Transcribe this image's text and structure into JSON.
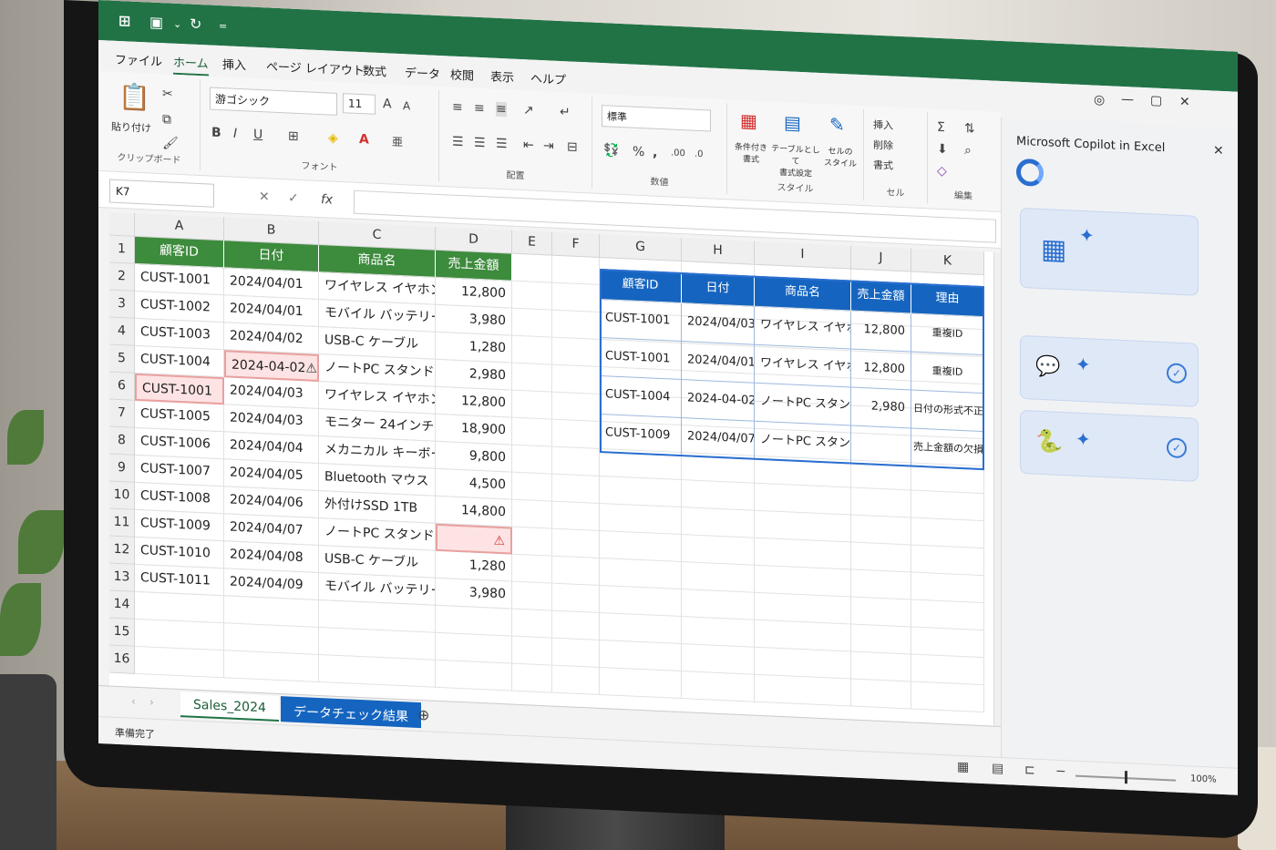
{
  "title_bar": {
    "undo_icon": "undo-icon",
    "redo_icon": "redo-icon"
  },
  "menu": [
    "ファイル",
    "ホーム",
    "挿入",
    "ページ レイアウト",
    "数式",
    "データ",
    "校閲",
    "表示",
    "ヘルプ"
  ],
  "ribbon": {
    "clipboard": {
      "paste": "貼り付け",
      "label": "クリップボード"
    },
    "font": {
      "name": "游ゴシック",
      "size": "11",
      "label": "フォント",
      "bold": "B",
      "italic": "I",
      "underline": "U"
    },
    "align": {
      "label": "配置"
    },
    "number": {
      "format": "標準",
      "label": "数値"
    },
    "styles": {
      "cond": "条件付き\n書式",
      "table": "テーブルとして\n書式設定",
      "cell": "セルの\nスタイル",
      "label": "スタイル"
    },
    "cells": {
      "insert": "挿入",
      "delete": "削除",
      "format": "書式",
      "label": "セル"
    },
    "edit": {
      "label": "編集"
    }
  },
  "formula": {
    "namebox": "K7",
    "fx": "fx"
  },
  "columns": [
    "A",
    "B",
    "C",
    "D",
    "E",
    "F",
    "G",
    "H",
    "I",
    "J",
    "K"
  ],
  "rows": [
    "1",
    "2",
    "3",
    "4",
    "5",
    "6",
    "7",
    "8",
    "9",
    "10",
    "11",
    "12",
    "13",
    "14",
    "15",
    "16"
  ],
  "table_headers": [
    "顧客ID",
    "日付",
    "商品名",
    "売上金額"
  ],
  "table_rows": [
    [
      "CUST-1001",
      "2024/04/01",
      "ワイヤレス イヤホン",
      "12,800"
    ],
    [
      "CUST-1002",
      "2024/04/01",
      "モバイル バッテリー",
      "3,980"
    ],
    [
      "CUST-1003",
      "2024/04/02",
      "USB-C ケーブル",
      "1,280"
    ],
    [
      "CUST-1004",
      "2024-04-02⚠",
      "ノートPC スタンド",
      "2,980"
    ],
    [
      "CUST-1001",
      "2024/04/03",
      "ワイヤレス イヤホン",
      "12,800"
    ],
    [
      "CUST-1005",
      "2024/04/03",
      "モニター 24インチ",
      "18,900"
    ],
    [
      "CUST-1006",
      "2024/04/04",
      "メカニカル キーボード",
      "9,800"
    ],
    [
      "CUST-1007",
      "2024/04/05",
      "Bluetooth マウス",
      "4,500"
    ],
    [
      "CUST-1008",
      "2024/04/06",
      "外付けSSD 1TB",
      "14,800"
    ],
    [
      "CUST-1009",
      "2024/04/07",
      "ノートPC スタンド",
      "⚠"
    ],
    [
      "CUST-1010",
      "2024/04/08",
      "USB-C ケーブル",
      "1,280"
    ],
    [
      "CUST-1011",
      "2024/04/09",
      "モバイル バッテリー",
      "3,980"
    ]
  ],
  "check_headers": [
    "顧客ID",
    "日付",
    "商品名",
    "売上金額",
    "理由"
  ],
  "check_rows": [
    [
      "CUST-1001",
      "2024/04/03",
      "ワイヤレス イヤホン",
      "12,800",
      "重複ID"
    ],
    [
      "CUST-1001",
      "2024/04/01",
      "ワイヤレス イヤホン",
      "12,800",
      "重複ID"
    ],
    [
      "CUST-1004",
      "2024-04-02",
      "ノートPC スタンド",
      "2,980",
      "日付の形式不正"
    ],
    [
      "CUST-1009",
      "2024/04/07",
      "ノートPC スタンド",
      "",
      "売上金額の欠損"
    ]
  ],
  "sheets": {
    "tab1": "Sales_2024",
    "tab2": "データチェック結果",
    "add": "⊕"
  },
  "status": {
    "ready": "準備完了",
    "zoom": "100%"
  },
  "copilot": {
    "title": "Microsoft Copilot in Excel",
    "close": "✕",
    "check": "✓"
  },
  "colors": {
    "excel_green": "#217346",
    "header_green": "#3d8b3d",
    "blue": "#1565c0",
    "error": "#fde3e3"
  }
}
